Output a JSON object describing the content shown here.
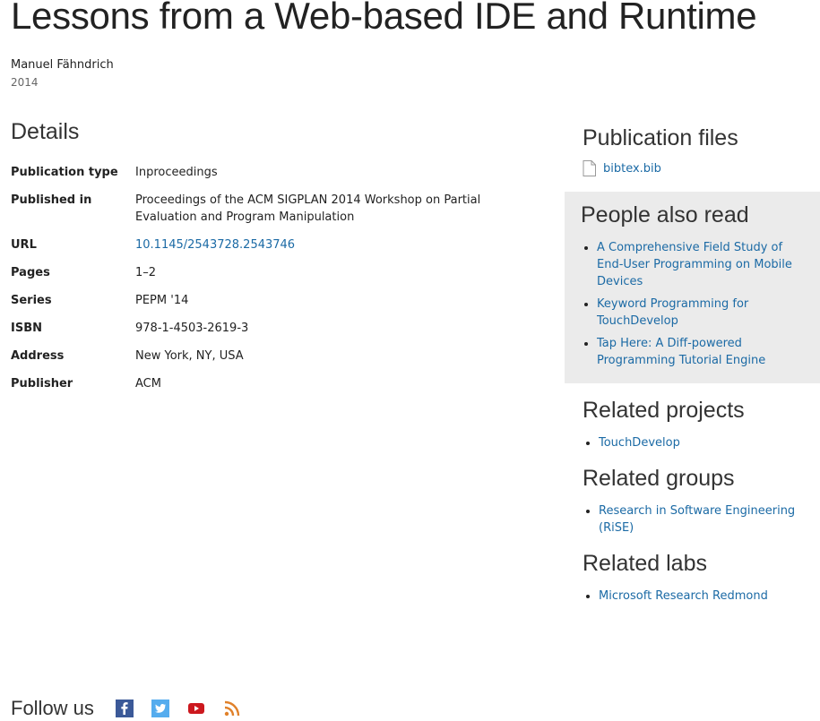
{
  "page": {
    "title": "Lessons from a Web-based IDE and Runtime",
    "author": "Manuel Fähndrich",
    "year": "2014"
  },
  "details": {
    "heading": "Details",
    "rows": [
      {
        "label": "Publication type",
        "value": "Inproceedings"
      },
      {
        "label": "Published in",
        "value": "Proceedings of the ACM SIGPLAN 2014 Workshop on Partial Evaluation and Program Manipulation"
      },
      {
        "label": "URL",
        "value": "10.1145/2543728.2543746"
      },
      {
        "label": "Pages",
        "value": "1–2"
      },
      {
        "label": "Series",
        "value": "PEPM '14"
      },
      {
        "label": "ISBN",
        "value": "978-1-4503-2619-3"
      },
      {
        "label": "Address",
        "value": "New York, NY, USA"
      },
      {
        "label": "Publisher",
        "value": "ACM"
      }
    ]
  },
  "publication_files": {
    "heading": "Publication files",
    "files": [
      {
        "name": "bibtex.bib",
        "icon": "file-icon"
      }
    ]
  },
  "people_also_read": {
    "heading": "People also read",
    "items": [
      "A Comprehensive Field Study of End-User Programming on Mobile Devices",
      "Keyword Programming for TouchDevelop",
      "Tap Here: A Diff-powered Programming Tutorial Engine"
    ]
  },
  "related_projects": {
    "heading": "Related projects",
    "items": [
      "TouchDevelop"
    ]
  },
  "related_groups": {
    "heading": "Related groups",
    "items": [
      "Research in Software Engineering (RiSE)"
    ]
  },
  "related_labs": {
    "heading": "Related labs",
    "items": [
      "Microsoft Research Redmond"
    ]
  },
  "footer": {
    "follow_label": "Follow us",
    "social": [
      {
        "name": "facebook-icon",
        "color": "#3b5998"
      },
      {
        "name": "twitter-icon",
        "color": "#1da1f2"
      },
      {
        "name": "youtube-icon",
        "color": "#cc181e"
      },
      {
        "name": "rss-icon",
        "color": "#e0812a"
      }
    ]
  },
  "colors": {
    "link": "#1b6aa5",
    "sidebar_bg": "#ebebeb"
  }
}
